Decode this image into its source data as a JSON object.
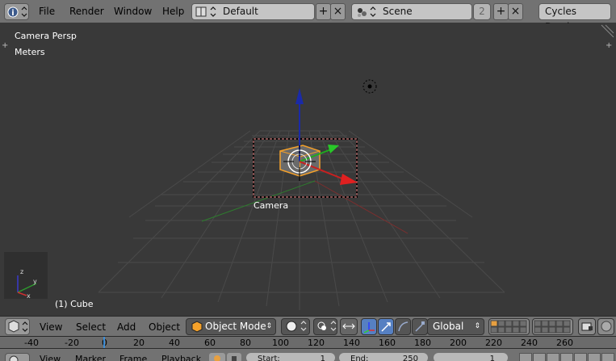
{
  "top_bar": {
    "menus": [
      "File",
      "Render",
      "Window",
      "Help"
    ],
    "screen_layout": "Default",
    "scene": "Scene",
    "scene_users": "2",
    "render_engine": "Cycles Render"
  },
  "viewport": {
    "view_name": "Camera Persp",
    "units": "Meters",
    "object_label": "Camera",
    "active_object": "(1) Cube"
  },
  "view_header": {
    "menus": [
      "View",
      "Select",
      "Add",
      "Object"
    ],
    "mode": "Object Mode",
    "orientation": "Global"
  },
  "ruler": {
    "ticks": [
      "-40",
      "-20",
      "0",
      "20",
      "40",
      "60",
      "80",
      "100",
      "120",
      "140",
      "160",
      "180",
      "200",
      "220",
      "240",
      "260"
    ]
  },
  "timeline_header": {
    "menus": [
      "View",
      "Marker",
      "Frame",
      "Playback"
    ],
    "start_label": "Start:",
    "start_value": "1",
    "end_label": "End:",
    "end_value": "250",
    "current_frame": "1"
  }
}
